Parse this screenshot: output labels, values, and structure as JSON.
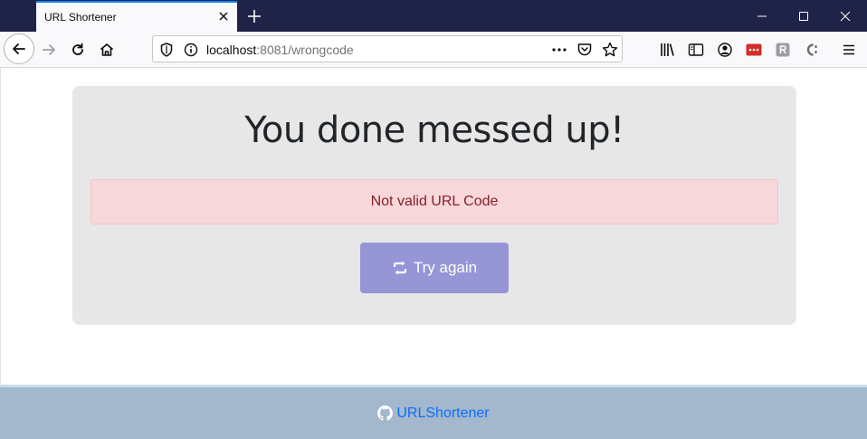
{
  "browser": {
    "tab_title": "URL Shortener",
    "url_host": "localhost",
    "url_rest": ":8081/wrongcode"
  },
  "page": {
    "heading": "You done messed up!",
    "alert": "Not valid URL Code",
    "try_again_label": "Try again",
    "footer_link": "URLShortener"
  },
  "colors": {
    "titlebar": "#1f2347",
    "card": "#e7e7e7",
    "alert_bg": "#f8d7da",
    "alert_text": "#842029",
    "button": "#9696d6",
    "footer": "#a3b7cd",
    "link": "#0d6efd"
  }
}
